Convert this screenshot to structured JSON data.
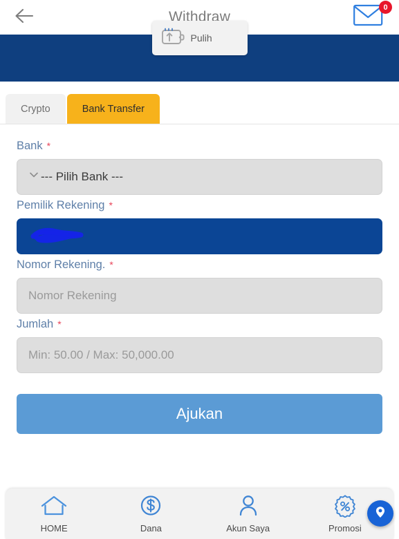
{
  "header": {
    "title": "Withdraw",
    "back_icon": "arrow-left-icon",
    "mail_icon": "envelope-icon",
    "mail_badge_count": "0"
  },
  "banner": {
    "card": {
      "label": "Pulih",
      "icon": "wallet-up-arrow-icon"
    }
  },
  "tabs": [
    {
      "label": "Crypto",
      "active": false
    },
    {
      "label": "Bank Transfer",
      "active": true
    }
  ],
  "form": {
    "fields": [
      {
        "label": "Bank",
        "required": "*",
        "type": "select",
        "value": "--- Pilih Bank ---",
        "icon": "chevron-down-icon"
      },
      {
        "label": "Pemilik Rekening",
        "required": "*",
        "type": "text-redacted",
        "value": ""
      },
      {
        "label": "Nomor Rekening.",
        "required": "*",
        "type": "text",
        "value": "",
        "placeholder": "Nomor Rekening"
      },
      {
        "label": "Jumlah",
        "required": "*",
        "type": "text",
        "value": "",
        "placeholder": "Min: 50.00 / Max: 50,000.00"
      }
    ],
    "submit_label": "Ajukan"
  },
  "bottom_nav": {
    "items": [
      {
        "label": "HOME",
        "icon": "home-icon"
      },
      {
        "label": "Dana",
        "icon": "dollar-circle-icon"
      },
      {
        "label": "Akun Saya",
        "icon": "person-icon"
      },
      {
        "label": "Promosi",
        "icon": "percent-badge-icon"
      }
    ]
  },
  "fab": {
    "icon": "chat-pin-icon"
  },
  "colors": {
    "banner_blue": "#0f3f7f",
    "tab_active": "#f7b21b",
    "field_label": "#5e7fa8",
    "required_red": "#e8455a",
    "filled_field": "#0b4595",
    "submit_blue": "#5b9bd5",
    "badge_red": "#e8162b",
    "icon_blue": "#3f85d4",
    "fab_blue": "#1863d6"
  }
}
